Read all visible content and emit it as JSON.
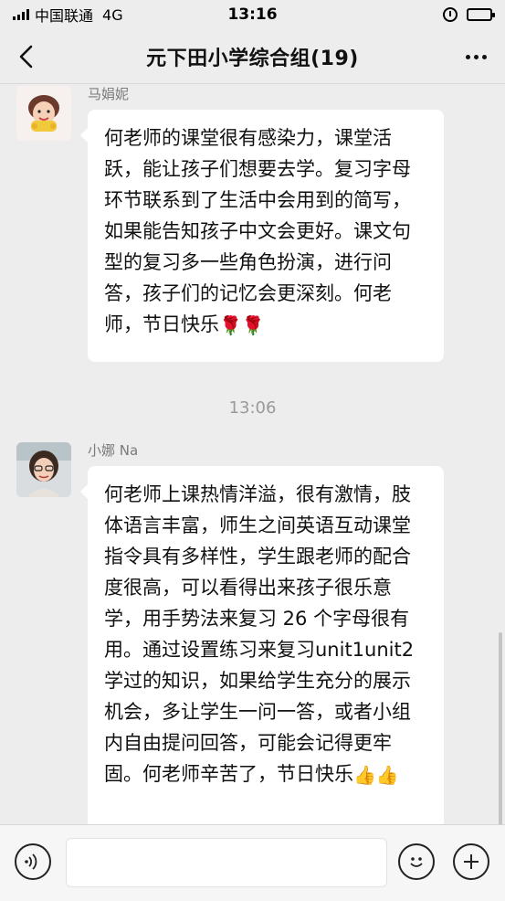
{
  "status_bar": {
    "carrier": "中国联通",
    "network": "4G",
    "time": "13:16"
  },
  "nav": {
    "title": "元下田小学综合组(19)"
  },
  "time_separator": "13:06",
  "messages": [
    {
      "sender": "马娟妮",
      "text": "何老师的课堂很有感染力，课堂活跃，能让孩子们想要去学。复习字母环节联系到了生活中会用到的简写，如果能告知孩子中文会更好。课文句型的复习多一些角色扮演，进行问答，孩子们的记忆会更深刻。何老师，节日快乐",
      "emojis": [
        "🌹",
        "🌹"
      ]
    },
    {
      "sender": "小娜 Na",
      "text": "何老师上课热情洋溢，很有激情，肢体语言丰富，师生之间英语互动课堂指令具有多样性，学生跟老师的配合度很高，可以看得出来孩子很乐意学，用手势法来复习 26 个字母很有用。通过设置练习来复习unit1unit2 学过的知识，如果给学生充分的展示机会，多让学生一问一答，或者小组内自由提问回答，可能会记得更牢固。何老师辛苦了，节日快乐",
      "emojis": [
        "👍",
        "👍"
      ]
    }
  ],
  "colors": {
    "background": "#ededed",
    "bubble": "#ffffff",
    "rose": "#d9262f"
  },
  "icons": {
    "back": "chevron-left-icon",
    "more": "more-dots-icon",
    "voice": "voice-icon",
    "emoji": "smiley-icon",
    "plus": "plus-icon"
  }
}
